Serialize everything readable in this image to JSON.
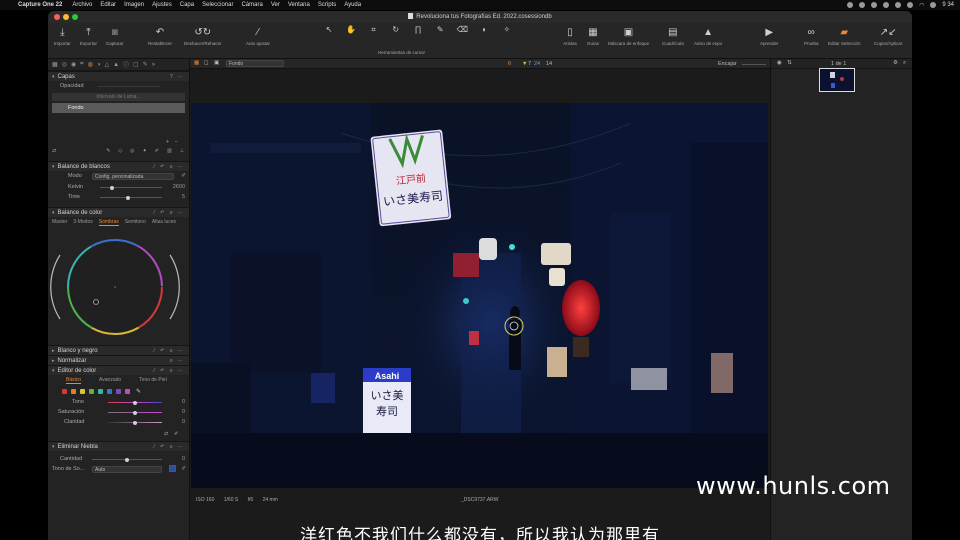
{
  "menubar": {
    "app_name": "Capture One 22",
    "items": [
      "Archivo",
      "Editar",
      "Imagen",
      "Ajustes",
      "Capa",
      "Seleccionar",
      "Cámara",
      "Ver",
      "Ventana",
      "Scripts",
      "Ayuda"
    ],
    "clock": "9 34"
  },
  "window": {
    "title": "Revoluciona tus Fotografías Ed. 2022.cosessiondb"
  },
  "toolbar": {
    "importar": "Importar",
    "exportar": "Exportar",
    "capturar": "Capturar",
    "restablecer": "Restablecer",
    "deshacer": "Deshacer/Rehacer",
    "auto_ajustar": "Auto ajustar",
    "herramientas_cursor": "Herramientas de cursor",
    "aristas": "Aristas",
    "guias": "Guías",
    "mascara_enfoque": "Máscara de enfoque",
    "cuadricula": "Cuadrícula",
    "aviso_expo": "Aviso de expo",
    "aprender": "Aprender",
    "prueba": "Prueba",
    "editar_seleccion": "Editar Selección",
    "copiar_aplicar": "Copiar/Aplicar"
  },
  "viewer_bar": {
    "layer": "Fondo",
    "counts": [
      "6",
      "7",
      "24",
      "14"
    ],
    "fit": "Encajar"
  },
  "layers": {
    "title": "Capas",
    "opacity_label": "Opacidad",
    "gradient_button": "Intervalo de Luma...",
    "layer_name": "Fondo"
  },
  "white_balance": {
    "title": "Balance de blancos",
    "mode_label": "Modo",
    "mode_value": "Config. personalizada",
    "kelvin_label": "Kelvin",
    "kelvin_value": "2600",
    "tint_label": "Tinte",
    "tint_value": "5",
    "kelvin_level": 0.2,
    "tint_level": 0.45
  },
  "color_balance": {
    "title": "Balance de color",
    "tabs": [
      "Master",
      "3-Modos",
      "Sombras",
      "Semitono",
      "Altas luces"
    ],
    "active_tab": "Sombras"
  },
  "collapsed_sections": {
    "bw": "Blanco y negro",
    "normalize": "Normalizar"
  },
  "color_editor": {
    "title": "Editor de color",
    "tabs": [
      "Básico",
      "Avanzado",
      "Tono de Piel"
    ],
    "active_tab": "Básico",
    "swatches": [
      "#d23a3a",
      "#e07c2e",
      "#d7c43a",
      "#64b042",
      "#3bb49e",
      "#3b77c9",
      "#7a49c2",
      "#c94ab2"
    ],
    "tone_label": "Tono",
    "tone_value": "0",
    "saturation_label": "Saturación",
    "saturation_value": "0",
    "clarity_label": "Claridad",
    "clarity_value": "0"
  },
  "dehaze": {
    "title": "Eliminar Niebla",
    "amount_label": "Cantidad",
    "amount_value": "0",
    "tone_label": "Tono de So...",
    "tone_value": "Auto"
  },
  "image_meta": {
    "iso": "ISO 160",
    "shutter": "1/60 S",
    "aperture": "f/6",
    "focal": "24 mm",
    "filename": "_DSC9737.ARW"
  },
  "browser": {
    "count": "1 de 1"
  },
  "photo_signs": {
    "top_sign_line1": "江戸前",
    "top_sign_line2": "いさ美寿司",
    "bottom_sign_brand": "Asahi",
    "bottom_sign_line1": "いさ美",
    "bottom_sign_line2": "寿司"
  },
  "subtitle": "洋红色不我们什么都没有，所以我认为那里有",
  "watermark": "www.hunls.com"
}
